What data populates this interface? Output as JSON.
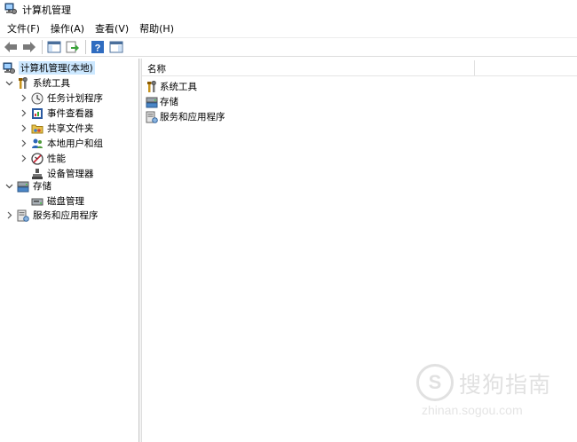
{
  "window": {
    "title": "计算机管理",
    "icon": "computer-management-icon"
  },
  "menu": [
    {
      "label": "文件(F)"
    },
    {
      "label": "操作(A)"
    },
    {
      "label": "查看(V)"
    },
    {
      "label": "帮助(H)"
    }
  ],
  "toolbar": {
    "buttons": [
      "back-arrow-icon",
      "forward-arrow-icon",
      "show-hide-tree-icon",
      "export-list-icon",
      "help-icon",
      "show-action-pane-icon"
    ]
  },
  "tree": {
    "root": {
      "label": "计算机管理(本地)",
      "icon": "computer-management-icon",
      "selected": true
    },
    "items": [
      {
        "label": "系统工具",
        "icon": "tools-icon",
        "expanded": true,
        "level": 1
      },
      {
        "label": "任务计划程序",
        "icon": "clock-icon",
        "expanded": false,
        "level": 2
      },
      {
        "label": "事件查看器",
        "icon": "event-viewer-icon",
        "expanded": false,
        "level": 2
      },
      {
        "label": "共享文件夹",
        "icon": "shared-folder-icon",
        "expanded": false,
        "level": 2
      },
      {
        "label": "本地用户和组",
        "icon": "users-icon",
        "expanded": false,
        "level": 2
      },
      {
        "label": "性能",
        "icon": "performance-icon",
        "expanded": false,
        "level": 2
      },
      {
        "label": "设备管理器",
        "icon": "device-manager-icon",
        "level": 2
      },
      {
        "label": "存储",
        "icon": "storage-icon",
        "expanded": true,
        "level": 1
      },
      {
        "label": "磁盘管理",
        "icon": "disk-icon",
        "level": 2
      },
      {
        "label": "服务和应用程序",
        "icon": "services-icon",
        "expanded": false,
        "level": 1
      }
    ]
  },
  "content": {
    "column_header": "名称",
    "items": [
      {
        "label": "系统工具",
        "icon": "tools-icon"
      },
      {
        "label": "存储",
        "icon": "storage-icon"
      },
      {
        "label": "服务和应用程序",
        "icon": "services-icon"
      }
    ]
  },
  "watermark": {
    "logo": "S",
    "text": "搜狗指南",
    "url": "zhinan.sogou.com"
  }
}
